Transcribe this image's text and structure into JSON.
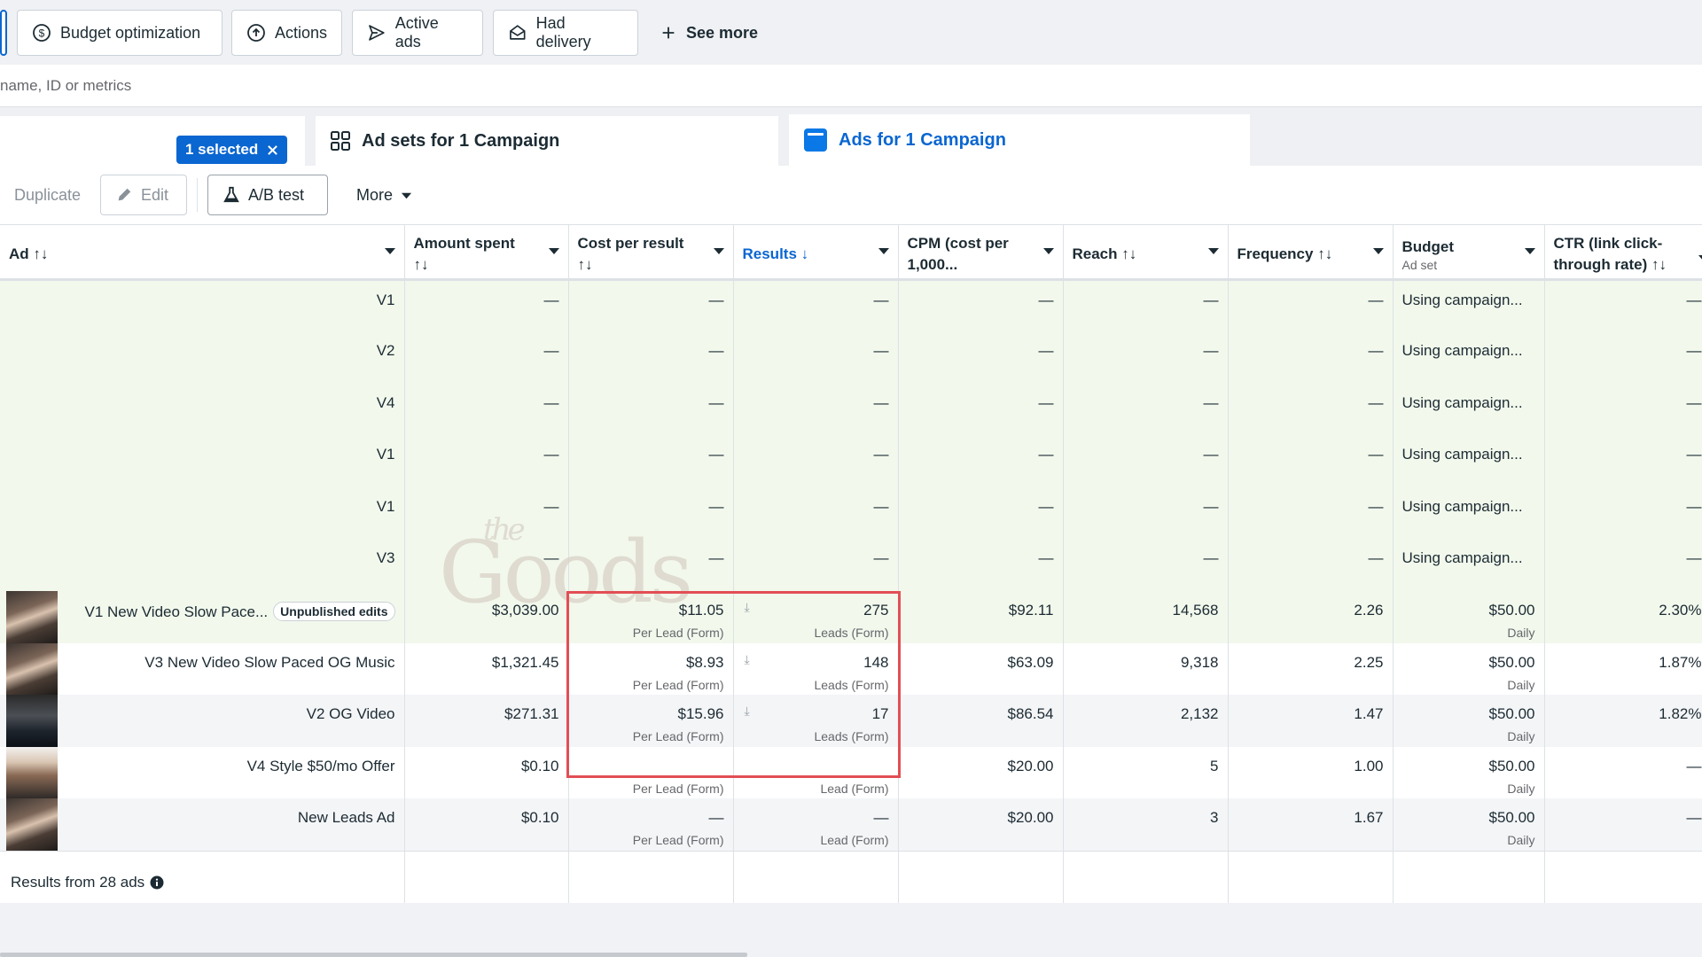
{
  "filters": {
    "budget_optimization": "Budget optimization",
    "actions": "Actions",
    "active_ads": "Active ads",
    "had_delivery": "Had delivery",
    "see_more": "See more"
  },
  "search": {
    "placeholder": "name, ID or metrics"
  },
  "tabs": {
    "selected_count": "1 selected",
    "ad_sets": "Ad sets for 1 Campaign",
    "ads": "Ads for 1 Campaign"
  },
  "toolbar": {
    "duplicate": "Duplicate",
    "edit": "Edit",
    "ab_test": "A/B test",
    "more": "More"
  },
  "columns": {
    "ad": "Ad",
    "amount_spent": "Amount spent",
    "cost_per_result": "Cost per result",
    "results": "Results",
    "cpm": "CPM (cost per 1,000...",
    "reach": "Reach",
    "frequency": "Frequency",
    "budget": "Budget",
    "budget_sub": "Ad set",
    "ctr": "CTR (link click-through rate)"
  },
  "sort_icons": {
    "both": "↑↓",
    "down": "↓"
  },
  "rows": [
    {
      "name": "V1",
      "spent": "—",
      "cpr": "—",
      "results": "—",
      "cpm": "—",
      "reach": "—",
      "freq": "—",
      "budget": "Using campaign...",
      "ctr": "—"
    },
    {
      "name": "V2",
      "spent": "—",
      "cpr": "—",
      "results": "—",
      "cpm": "—",
      "reach": "—",
      "freq": "—",
      "budget": "Using campaign...",
      "ctr": "—"
    },
    {
      "name": "V4",
      "spent": "—",
      "cpr": "—",
      "results": "—",
      "cpm": "—",
      "reach": "—",
      "freq": "—",
      "budget": "Using campaign...",
      "ctr": "—"
    },
    {
      "name": "V1",
      "spent": "—",
      "cpr": "—",
      "results": "—",
      "cpm": "—",
      "reach": "—",
      "freq": "—",
      "budget": "Using campaign...",
      "ctr": "—"
    },
    {
      "name": "V1",
      "spent": "—",
      "cpr": "—",
      "results": "—",
      "cpm": "—",
      "reach": "—",
      "freq": "—",
      "budget": "Using campaign...",
      "ctr": "—"
    },
    {
      "name": "V3",
      "spent": "—",
      "cpr": "—",
      "results": "—",
      "cpm": "—",
      "reach": "—",
      "freq": "—",
      "budget": "Using campaign...",
      "ctr": "—"
    },
    {
      "name": "V1 New Video Slow Pace...",
      "badge": "Unpublished edits",
      "spent": "$3,039.00",
      "cpr": "$11.05",
      "cpr_sub": "Per Lead (Form)",
      "results": "275",
      "results_sub": "Leads (Form)",
      "cpm": "$92.11",
      "reach": "14,568",
      "freq": "2.26",
      "budget": "$50.00",
      "budget_sub": "Daily",
      "ctr": "2.30%"
    },
    {
      "name": "V3 New Video Slow Paced OG Music",
      "spent": "$1,321.45",
      "cpr": "$8.93",
      "cpr_sub": "Per Lead (Form)",
      "results": "148",
      "results_sub": "Leads (Form)",
      "cpm": "$63.09",
      "reach": "9,318",
      "freq": "2.25",
      "budget": "$50.00",
      "budget_sub": "Daily",
      "ctr": "1.87%"
    },
    {
      "name": "V2 OG Video",
      "spent": "$271.31",
      "cpr": "$15.96",
      "cpr_sub": "Per Lead (Form)",
      "results": "17",
      "results_sub": "Leads (Form)",
      "cpm": "$86.54",
      "reach": "2,132",
      "freq": "1.47",
      "budget": "$50.00",
      "budget_sub": "Daily",
      "ctr": "1.82%"
    },
    {
      "name": "V4 Style $50/mo Offer",
      "spent": "$0.10",
      "cpr": "",
      "cpr_sub": "Per Lead (Form)",
      "results": "",
      "results_sub": "Lead (Form)",
      "cpm": "$20.00",
      "reach": "5",
      "freq": "1.00",
      "budget": "$50.00",
      "budget_sub": "Daily",
      "ctr": "—"
    },
    {
      "name": "New Leads Ad",
      "spent": "$0.10",
      "cpr": "—",
      "cpr_sub": "Per Lead (Form)",
      "results": "—",
      "results_sub": "Lead (Form)",
      "cpm": "$20.00",
      "reach": "3",
      "freq": "1.67",
      "budget": "$50.00",
      "budget_sub": "Daily",
      "ctr": "—"
    }
  ],
  "footer": {
    "results_from": "Results from 28 ads"
  },
  "watermark": {
    "small": "the",
    "big": "Goods"
  }
}
